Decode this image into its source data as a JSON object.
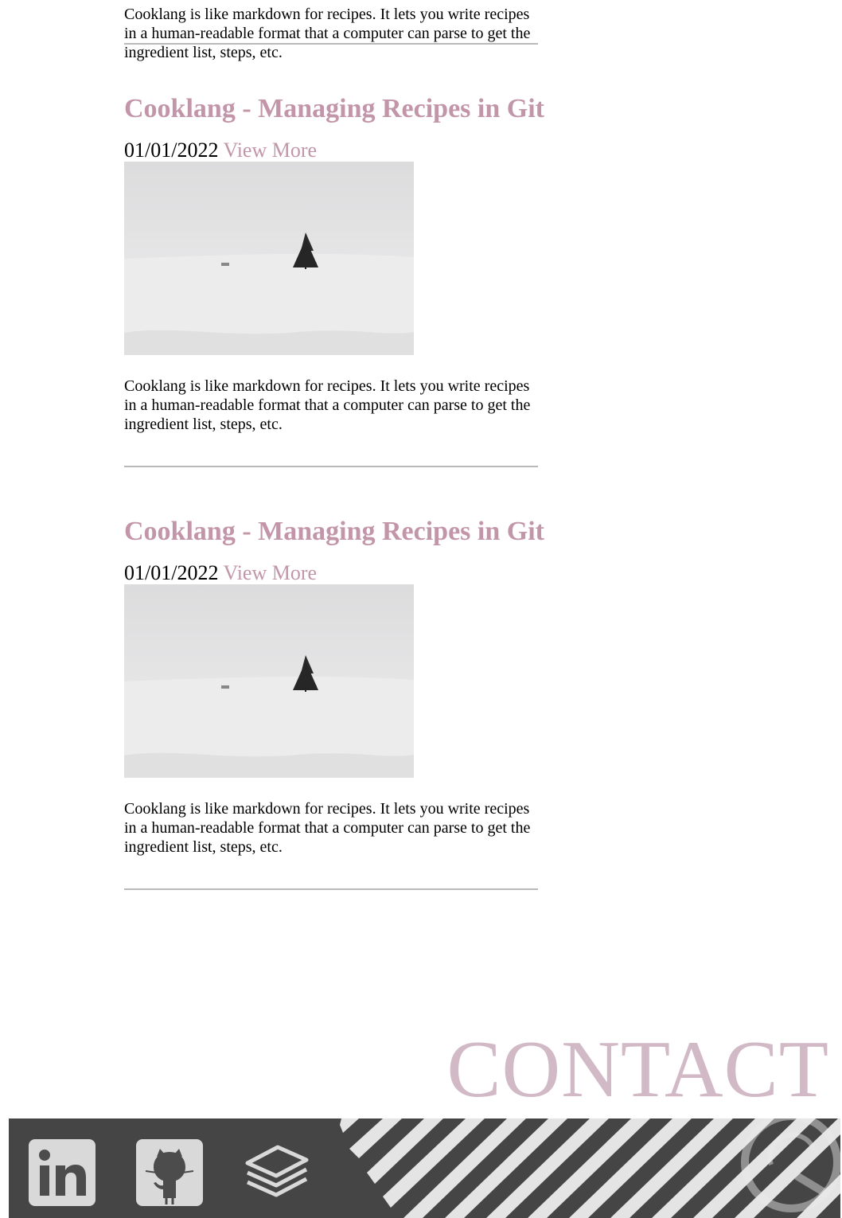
{
  "posts": [
    {
      "excerpt": "Cooklang is like markdown for recipes. It lets you write recipes in a human-readable format that a computer can parse to get the ingredient list, steps, etc."
    },
    {
      "title": "Cooklang - Managing Recipes in Git",
      "date": "01/01/2022",
      "view_more": "View More",
      "image_alt": "Lone tree on a snowy hill",
      "excerpt": "Cooklang is like markdown for recipes. It lets you write recipes in a human-readable format that a computer can parse to get the ingredient list, steps, etc."
    },
    {
      "title": "Cooklang - Managing Recipes in Git",
      "date": "01/01/2022",
      "view_more": "View More",
      "image_alt": "Lone tree on a snowy hill",
      "excerpt": "Cooklang is like markdown for recipes. It lets you write recipes in a human-readable format that a computer can parse to get the ingredient list, steps, etc."
    }
  ],
  "contact": {
    "heading": "CONTACT"
  },
  "footer": {
    "social_links": [
      {
        "icon": "linkedin-icon"
      },
      {
        "icon": "github-icon"
      },
      {
        "icon": "stack-icon"
      }
    ]
  },
  "colors": {
    "accent": "#c295a8",
    "contact_heading": "#d2b9c6",
    "footer_background": "#4a4a4a",
    "icon_fill": "#d9d9d9"
  }
}
